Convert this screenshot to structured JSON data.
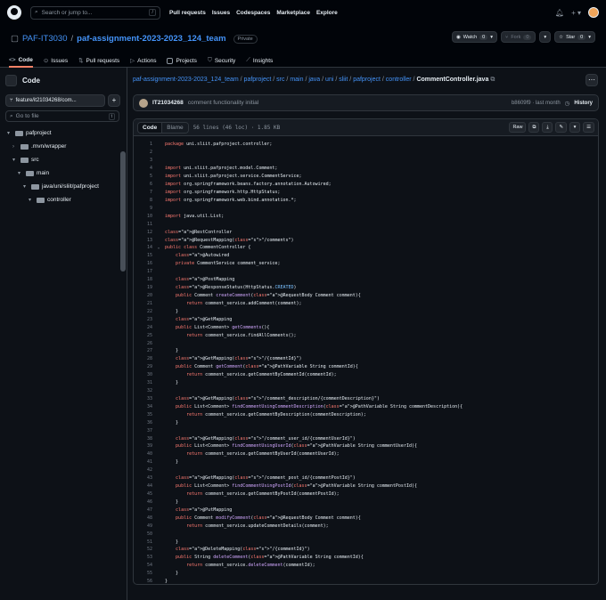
{
  "topbar": {
    "search_placeholder": "Search or jump to...",
    "search_key": "/",
    "nav": [
      "Pull requests",
      "Issues",
      "Codespaces",
      "Marketplace",
      "Explore"
    ],
    "bell_icon": "bell-icon",
    "plus_label": "+ ▾"
  },
  "repo": {
    "owner": "PAF-IT3030",
    "name": "paf-assignment-2023-2023_124_team",
    "visibility": "Private",
    "watch_label": "Watch",
    "watch_count": "0",
    "fork_label": "Fork",
    "fork_count": "0",
    "star_label": "Star",
    "star_count": "0"
  },
  "tabs": [
    {
      "label": "Code",
      "active": true
    },
    {
      "label": "Issues"
    },
    {
      "label": "Pull requests"
    },
    {
      "label": "Actions"
    },
    {
      "label": "Projects"
    },
    {
      "label": "Security"
    },
    {
      "label": "Insights"
    }
  ],
  "sidebar": {
    "title": "Code",
    "branch": "feature/it21034268/com...",
    "goto_placeholder": "Go to file",
    "goto_key": "t",
    "tree": [
      {
        "label": "pafproject",
        "depth": 0,
        "open": true
      },
      {
        "label": ".mvn/wrapper",
        "depth": 1,
        "open": false
      },
      {
        "label": "src",
        "depth": 1,
        "open": true
      },
      {
        "label": "main",
        "depth": 2,
        "open": true
      },
      {
        "label": "java/uni/sliit/pafproject",
        "depth": 3,
        "open": true
      },
      {
        "label": "controller",
        "depth": 4,
        "open": true
      }
    ]
  },
  "breadcrumb": {
    "parts": [
      "paf-assignment-2023-2023_124_team",
      "pafproject",
      "src",
      "main",
      "java",
      "uni",
      "sliit",
      "pafproject",
      "controller"
    ],
    "file": "CommentController.java"
  },
  "commit": {
    "author": "IT21034268",
    "message": "comment functionality initial",
    "meta": "b8609f9 · last month",
    "history_label": "History"
  },
  "file": {
    "tab_code": "Code",
    "tab_blame": "Blame",
    "info": "56 lines (46 loc) · 1.85 KB",
    "raw_label": "Raw"
  },
  "code": [
    "package uni.sliit.pafproject.controller;",
    "",
    "",
    "import uni.sliit.pafproject.model.Comment;",
    "import uni.sliit.pafproject.service.CommentService;",
    "import org.springframework.beans.factory.annotation.Autowired;",
    "import org.springframework.http.HttpStatus;",
    "import org.springframework.web.bind.annotation.*;",
    "",
    "import java.util.List;",
    "",
    "@RestController",
    "@RequestMapping(\"/comments\")",
    "public class CommentController {",
    "    @Autowired",
    "    private CommentService comment_service;",
    "",
    "    @PostMapping",
    "    @ResponseStatus(HttpStatus.CREATED)",
    "    public Comment createComment(@RequestBody Comment comment){",
    "        return comment_service.addComment(comment);",
    "    }",
    "    @GetMapping",
    "    public List<Comment> getComments(){",
    "        return comment_service.findAllComments();",
    "",
    "    }",
    "    @GetMapping(\"/{commentId}\")",
    "    public Comment getComment(@PathVariable String commentId){",
    "        return comment_service.getCommentByCommentId(commentId);",
    "    }",
    "",
    "    @GetMapping(\"/comment_description/{commentDescription}\")",
    "    public List<Comment> findCommentUsingCommentDescription(@PathVariable String commentDescription){",
    "        return comment_service.getCommentByDescription(commentDescription);",
    "    }",
    "",
    "    @GetMapping(\"/comment_user_id/{commentUserId}\")",
    "    public List<Comment> findCommentUsingUserId(@PathVariable String commentUserId){",
    "        return comment_service.getCommentByUserId(commentUserId);",
    "    }",
    "",
    "    @GetMapping(\"/comment_post_id/{commentPostId}\")",
    "    public List<Comment> findCommentUsingPostId(@PathVariable String commentPostId){",
    "        return comment_service.getCommentByPostId(commentPostId);",
    "    }",
    "    @PutMapping",
    "    public Comment modifyComment(@RequestBody Comment comment){",
    "        return comment_service.updateCommentDetails(comment);",
    "",
    "    }",
    "    @DeleteMapping(\"/{commentId}\")",
    "    public String deleteComment(@PathVariable String commentId){",
    "        return comment_service.deleteComment(commentId);",
    "    }",
    "}"
  ]
}
